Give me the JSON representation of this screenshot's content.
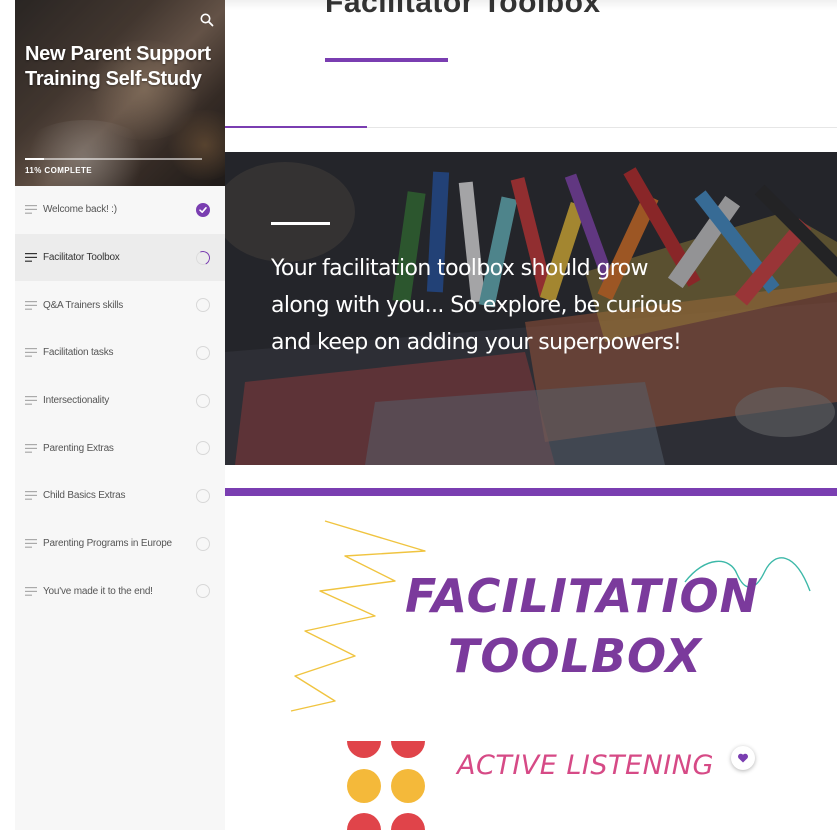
{
  "course": {
    "title": "New Parent Support Training Self-Study",
    "progress_label": "11% COMPLETE",
    "progress_fraction": 0.11
  },
  "lessons": [
    {
      "label": "Welcome back! :)",
      "status": "complete"
    },
    {
      "label": "Facilitator Toolbox",
      "status": "in-progress"
    },
    {
      "label": "Q&A Trainers skills",
      "status": "not-started"
    },
    {
      "label": "Facilitation tasks",
      "status": "not-started"
    },
    {
      "label": "Intersectionality",
      "status": "not-started"
    },
    {
      "label": "Parenting Extras",
      "status": "not-started"
    },
    {
      "label": "Child Basics Extras",
      "status": "not-started"
    },
    {
      "label": "Parenting Programs in Europe",
      "status": "not-started"
    },
    {
      "label": "You've made it to the end!",
      "status": "not-started"
    }
  ],
  "main": {
    "page_title": "Facilitator Toolbox",
    "banner_text": "Your facilitation toolbox should grow along with you... So explore, be curious and keep on adding your superpowers!",
    "graphic": {
      "title_line1": "FACILITATION",
      "title_line2": "TOOLBOX",
      "section_label": "ACTIVE LISTENING"
    }
  },
  "icons": {
    "search": "search-icon",
    "lesson_lines": "lines-icon",
    "check": "check-icon",
    "heart": "heart-icon"
  },
  "colors": {
    "accent": "#7a3eb1",
    "graphic_title": "#7b3a9c",
    "graphic_label": "#d64a86",
    "sidebar_bg": "#f7f7f7"
  }
}
